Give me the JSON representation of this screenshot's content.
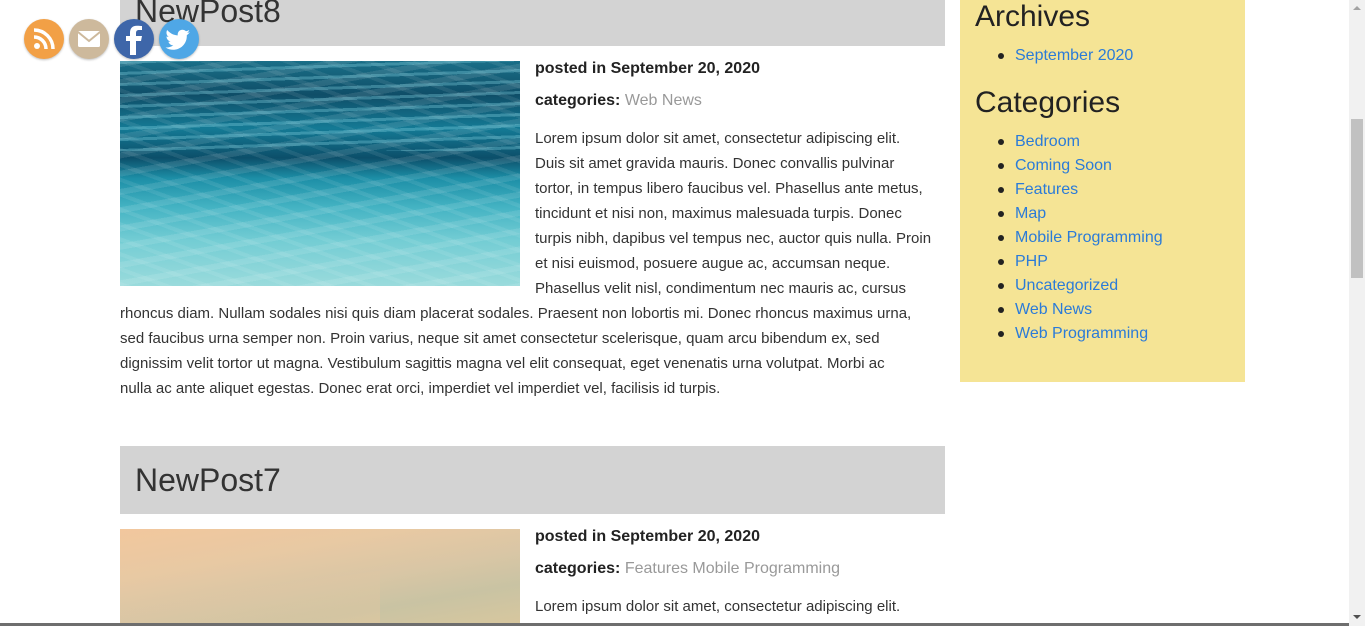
{
  "social": {
    "icons": [
      "rss-icon",
      "email-icon",
      "facebook-icon",
      "twitter-icon"
    ],
    "colors": {
      "rss": "#f2a046",
      "email": "#cdb99c",
      "facebook": "#3e66a9",
      "twitter": "#4fa7e6"
    }
  },
  "posts": [
    {
      "title": "NewPost8",
      "posted_label": "posted in",
      "posted_date": "September 20, 2020",
      "categories_label": "categories:",
      "categories": "Web News",
      "body_lines_right": [
        "Lorem ipsum dolor sit amet, consectetur adipiscing elit.",
        "Duis sit amet gravida mauris. Donec convallis pulvinar",
        "tortor, in tempus libero faucibus vel. Phasellus ante metus,",
        "tincidunt et nisi non, maximus malesuada turpis. Donec",
        "turpis nibh, dapibus vel tempus nec, auctor quis nulla. Proin",
        "et nisi euismod, posuere augue ac, accumsan neque.",
        "Phasellus velit nisl, condimentum nec mauris ac, cursus"
      ],
      "body_lines_full": [
        "rhoncus diam. Nullam sodales nisi quis diam placerat sodales. Praesent non lobortis mi. Donec rhoncus maximus urna,",
        "sed faucibus urna semper non. Proin varius, neque sit amet consectetur scelerisque, quam arcu bibendum ex, sed",
        "dignissim velit tortor ut magna. Vestibulum sagittis magna vel elit consequat, eget venenatis urna volutpat. Morbi ac",
        "nulla ac ante aliquet egestas. Donec erat orci, imperdiet vel imperdiet vel, facilisis id turpis."
      ]
    },
    {
      "title": "NewPost7",
      "posted_label": "posted in",
      "posted_date": "September 20, 2020",
      "categories_label": "categories:",
      "categories": "Features Mobile Programming",
      "body_lines_right": [
        "Lorem ipsum dolor sit amet, consectetur adipiscing elit."
      ]
    }
  ],
  "sidebar": {
    "archives_title": "Archives",
    "archives": [
      "September 2020"
    ],
    "categories_title": "Categories",
    "categories": [
      "Bedroom",
      "Coming Soon",
      "Features",
      "Map",
      "Mobile Programming",
      "PHP",
      "Uncategorized",
      "Web News",
      "Web Programming"
    ],
    "background": "#f5e495",
    "link_color": "#2b7bd8"
  }
}
